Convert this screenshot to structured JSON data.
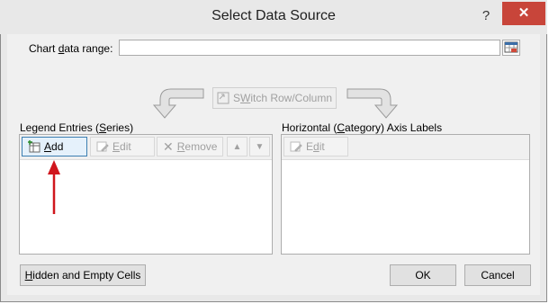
{
  "window": {
    "title": "Select Data Source",
    "help_glyph": "?",
    "close_glyph": "✕"
  },
  "range": {
    "label_prefix": "Chart ",
    "label_underline": "d",
    "label_suffix": "ata range:",
    "value": ""
  },
  "switch_button": {
    "label_underline": "W",
    "label_prefix": "S",
    "label_suffix": "itch Row/Column"
  },
  "legend": {
    "heading_prefix": "Legend Entries (",
    "heading_underline": "S",
    "heading_suffix": "eries)",
    "add_underline": "A",
    "add_suffix": "dd",
    "edit_underline": "E",
    "edit_suffix": "dit",
    "remove_underline": "R",
    "remove_suffix": "emove",
    "up_glyph": "▲",
    "down_glyph": "▼",
    "items": []
  },
  "axis": {
    "heading_prefix": "Horizontal (",
    "heading_underline": "C",
    "heading_suffix": "ategory) Axis Labels",
    "edit_underline": "d",
    "edit_prefix": "E",
    "edit_suffix": "it",
    "items": []
  },
  "footer": {
    "hidden_underline": "H",
    "hidden_suffix": "idden and Empty Cells",
    "ok_label": "OK",
    "cancel_label": "Cancel"
  },
  "colors": {
    "annotation_arrow": "#d0161d",
    "close_button": "#c8453a",
    "focus_border": "#3c7fb1"
  }
}
